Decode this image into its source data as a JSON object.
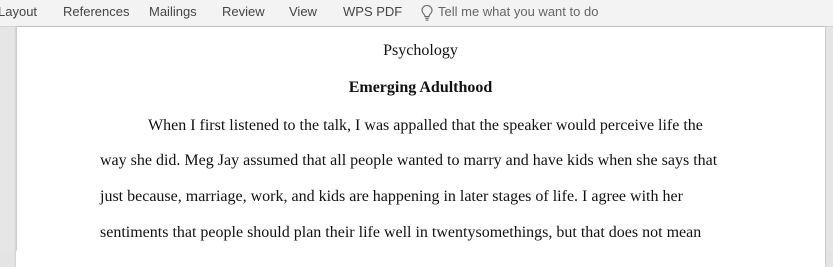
{
  "ribbon": {
    "tabs": [
      {
        "label": "Layout"
      },
      {
        "label": "References"
      },
      {
        "label": "Mailings"
      },
      {
        "label": "Review"
      },
      {
        "label": "View"
      },
      {
        "label": "WPS PDF"
      }
    ],
    "tell_me": {
      "placeholder": "Tell me what you want to do",
      "icon": "lightbulb-icon"
    }
  },
  "document": {
    "header_subject": "Psychology",
    "title": "Emerging Adulthood",
    "paragraph_lines": [
      "When I first listened to the talk, I was appalled that the speaker would perceive life the",
      "way she did. Meg Jay assumed that all people wanted to marry and have kids when she says that",
      "just because, marriage, work, and kids are happening in later stages of life. I agree with her",
      "sentiments that people should plan their life well in twentysomethings, but that does not mean"
    ]
  },
  "colors": {
    "ribbon_bg": "#f3f3f3",
    "workspace_bg": "#e6e6e6",
    "page_bg": "#ffffff"
  }
}
